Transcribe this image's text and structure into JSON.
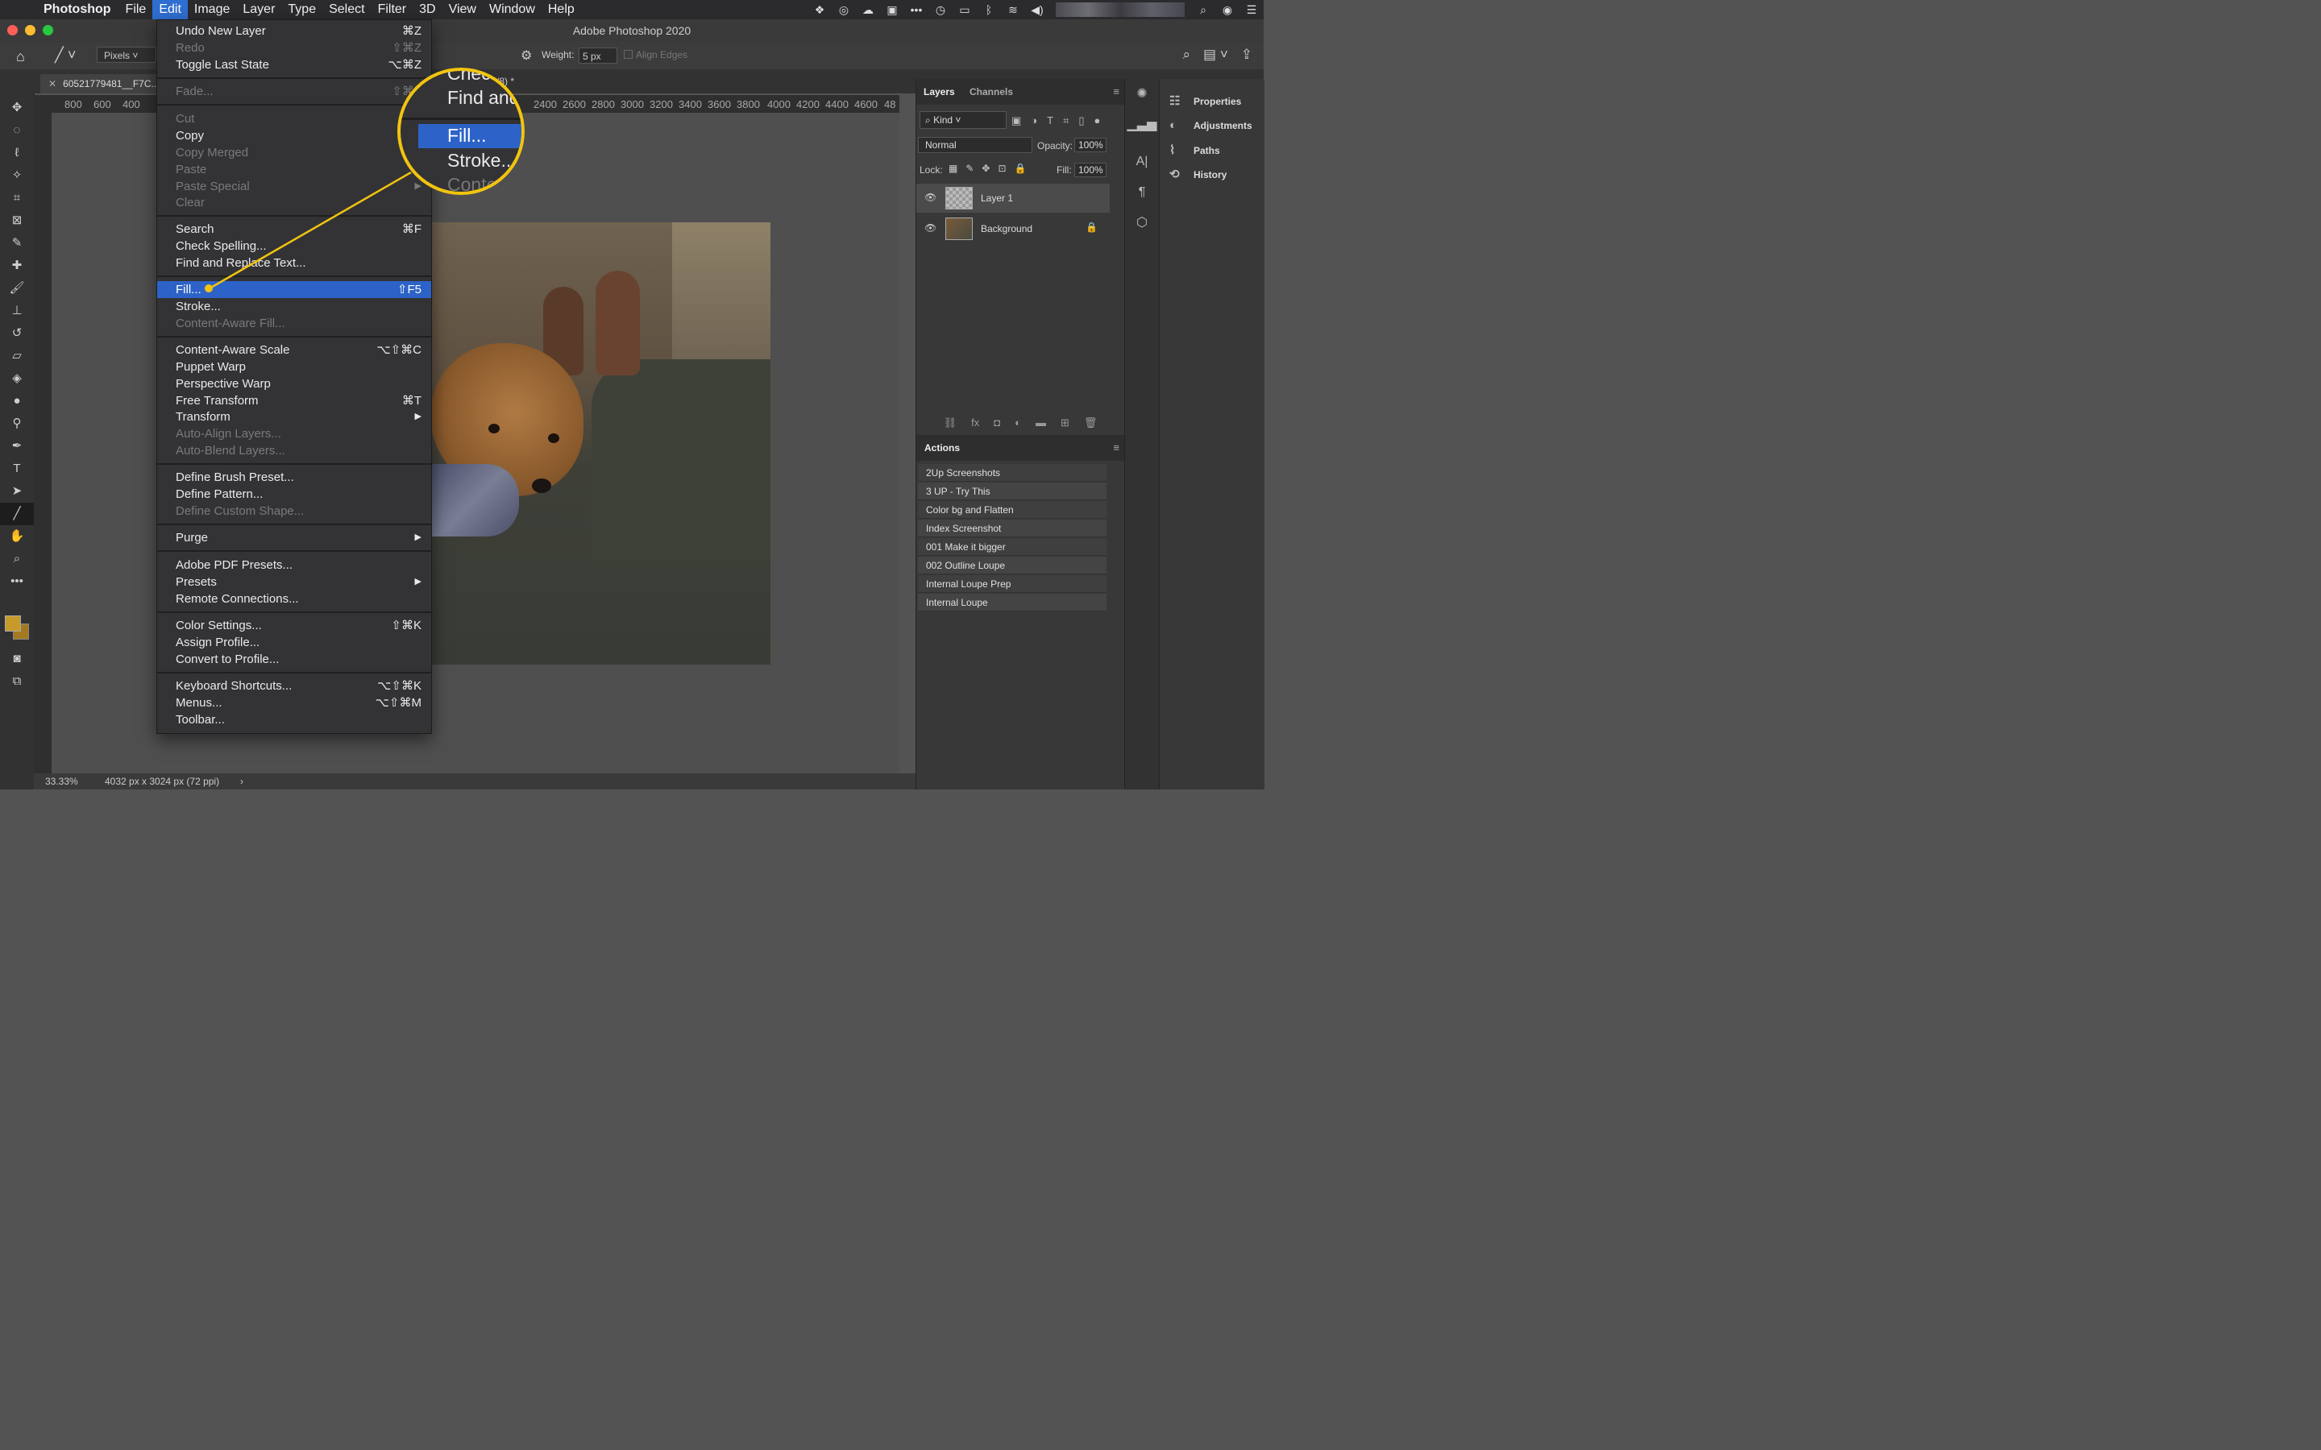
{
  "menubar": {
    "app": "Photoshop",
    "items": [
      "File",
      "Edit",
      "Image",
      "Layer",
      "Type",
      "Select",
      "Filter",
      "3D",
      "View",
      "Window",
      "Help"
    ],
    "active": "Edit"
  },
  "window": {
    "title": "Adobe Photoshop 2020"
  },
  "options": {
    "unit": "Pixels",
    "weight_label": "Weight:",
    "weight_value": "5 px",
    "align_edges": "Align Edges"
  },
  "document": {
    "tab_label": "60521779481__F7C...",
    "tab_suffix": "/8) *",
    "zoom": "33.33%",
    "dimensions": "4032 px x 3024 px (72 ppi)"
  },
  "ruler_h": [
    "800",
    "600",
    "400",
    "2400",
    "2600",
    "2800",
    "3000",
    "3200",
    "3400",
    "3600",
    "3800",
    "4000",
    "4200",
    "4400",
    "4600",
    "48"
  ],
  "edit_menu": {
    "undo": "Undo New Layer",
    "undo_sc": "⌘Z",
    "redo": "Redo",
    "redo_sc": "⇧⌘Z",
    "toggle": "Toggle Last State",
    "toggle_sc": "⌥⌘Z",
    "fade": "Fade...",
    "fade_sc": "⇧⌘F",
    "cut": "Cut",
    "copy": "Copy",
    "copy_merged": "Copy Merged",
    "paste": "Paste",
    "paste_special": "Paste Special",
    "clear": "Clear",
    "search": "Search",
    "search_sc": "⌘F",
    "check_spelling": "Check Spelling...",
    "find_replace": "Find and Replace Text...",
    "fill": "Fill...",
    "fill_sc": "⇧F5",
    "stroke": "Stroke...",
    "content_aware_fill": "Content-Aware Fill...",
    "content_aware_scale": "Content-Aware Scale",
    "content_aware_scale_sc": "⌥⇧⌘C",
    "puppet_warp": "Puppet Warp",
    "perspective_warp": "Perspective Warp",
    "free_transform": "Free Transform",
    "free_transform_sc": "⌘T",
    "transform": "Transform",
    "auto_align": "Auto-Align Layers...",
    "auto_blend": "Auto-Blend Layers...",
    "define_brush": "Define Brush Preset...",
    "define_pattern": "Define Pattern...",
    "define_shape": "Define Custom Shape...",
    "purge": "Purge",
    "pdf_presets": "Adobe PDF Presets...",
    "presets": "Presets",
    "remote": "Remote Connections...",
    "color_settings": "Color Settings...",
    "color_settings_sc": "⇧⌘K",
    "assign_profile": "Assign Profile...",
    "convert_profile": "Convert to Profile...",
    "keyboard": "Keyboard Shortcuts...",
    "keyboard_sc": "⌥⇧⌘K",
    "menus": "Menus...",
    "menus_sc": "⌥⇧⌘M",
    "toolbar": "Toolbar..."
  },
  "loupe": {
    "top": "Chec",
    "find": "Find and",
    "fill": "Fill...",
    "stroke": "Stroke...",
    "cont": "Conte"
  },
  "layers_panel": {
    "tab_layers": "Layers",
    "tab_channels": "Channels",
    "filter": "Kind",
    "blend_mode": "Normal",
    "opacity_label": "Opacity:",
    "opacity": "100%",
    "lock_label": "Lock:",
    "fill_label": "Fill:",
    "fill": "100%",
    "layers": [
      "Layer 1",
      "Background"
    ]
  },
  "actions_panel": {
    "title": "Actions",
    "items": [
      "2Up Screenshots",
      "3 UP - Try This",
      "Color bg and Flatten",
      "Index Screenshot",
      "001 Make it bigger",
      "002 Outline Loupe",
      "Internal Loupe Prep",
      "Internal Loupe"
    ]
  },
  "dock": {
    "items": [
      "Properties",
      "Adjustments",
      "Paths",
      "History"
    ]
  },
  "colors": {
    "accent": "#2d63c8",
    "loupe_border": "#f1c40f",
    "foreground": "#c89a2a"
  }
}
